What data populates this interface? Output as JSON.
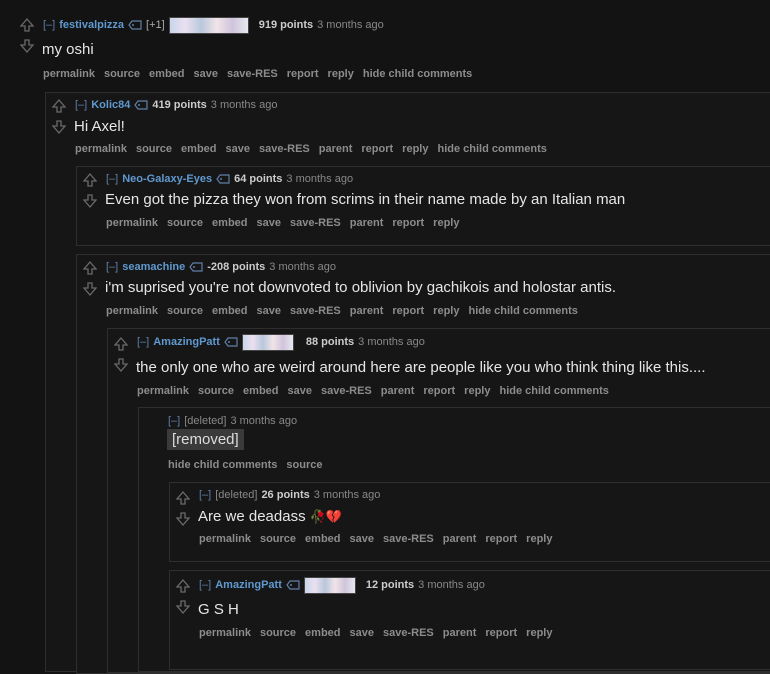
{
  "comments": [
    {
      "expand": "[–]",
      "author": "festivalpizza",
      "flair_text": "[+1]",
      "points": "919 points",
      "time": "3 months ago",
      "body": "my oshi",
      "buttons": [
        "permalink",
        "source",
        "embed",
        "save",
        "save-RES",
        "report",
        "reply",
        "hide child comments"
      ]
    },
    {
      "expand": "[–]",
      "author": "Kolic84",
      "points": "419 points",
      "time": "3 months ago",
      "body": "Hi Axel!",
      "buttons": [
        "permalink",
        "source",
        "embed",
        "save",
        "save-RES",
        "parent",
        "report",
        "reply",
        "hide child comments"
      ]
    },
    {
      "expand": "[–]",
      "author": "Neo-Galaxy-Eyes",
      "points": "64 points",
      "time": "3 months ago",
      "body": "Even got the pizza they won from scrims in their name made by an Italian man",
      "buttons": [
        "permalink",
        "source",
        "embed",
        "save",
        "save-RES",
        "parent",
        "report",
        "reply"
      ]
    },
    {
      "expand": "[–]",
      "author": "seamachine",
      "points": "-208 points",
      "time": "3 months ago",
      "body": "i'm suprised you're not downvoted to oblivion by gachikois and holostar antis.",
      "buttons": [
        "permalink",
        "source",
        "embed",
        "save",
        "save-RES",
        "parent",
        "report",
        "reply",
        "hide child comments"
      ]
    },
    {
      "expand": "[–]",
      "author": "AmazingPatt",
      "points": "88 points",
      "time": "3 months ago",
      "body": "the only one who are weird around here are people like you who think thing like this....",
      "buttons": [
        "permalink",
        "source",
        "embed",
        "save",
        "save-RES",
        "parent",
        "report",
        "reply",
        "hide child comments"
      ]
    },
    {
      "expand": "[–]",
      "author": "[deleted]",
      "time": "3 months ago",
      "body": "[removed]",
      "buttons": [
        "hide child comments",
        "source"
      ]
    },
    {
      "expand": "[–]",
      "author": "[deleted]",
      "points": "26 points",
      "time": "3 months ago",
      "body": "Are we deadass",
      "emoji": "🥀💔",
      "buttons": [
        "permalink",
        "source",
        "embed",
        "save",
        "save-RES",
        "parent",
        "report",
        "reply"
      ]
    },
    {
      "expand": "[–]",
      "author": "AmazingPatt",
      "points": "12 points",
      "time": "3 months ago",
      "body": "G S H",
      "buttons": [
        "permalink",
        "source",
        "embed",
        "save",
        "save-RES",
        "parent",
        "report",
        "reply"
      ]
    }
  ],
  "icons": {
    "upvote": "upvote-arrow-icon",
    "downvote": "downvote-arrow-icon",
    "tag": "user-tag-icon"
  },
  "colors": {
    "background": "#131313",
    "author": "#5f99cf",
    "button_text": "#8c8c8c",
    "box_border": "#2e2e2e"
  }
}
